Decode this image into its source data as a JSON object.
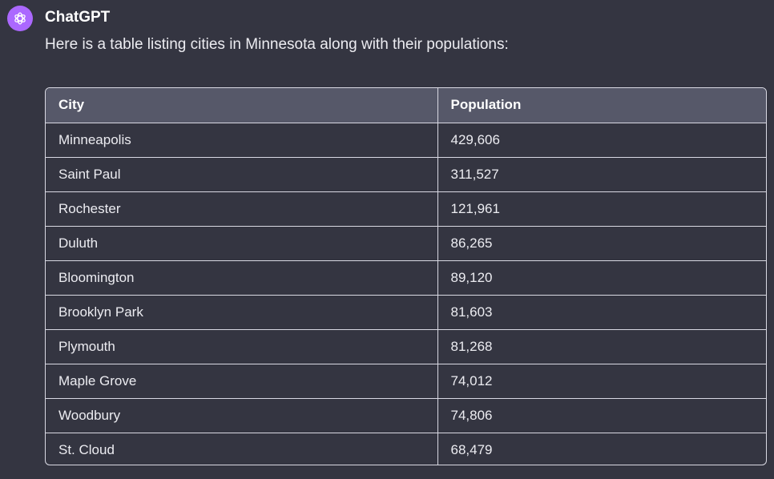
{
  "message": {
    "author": "ChatGPT",
    "avatar_icon": "openai-logo-icon",
    "avatar_color": "#ab68ff",
    "intro": "Here is a table listing cities in Minnesota along with their populations:"
  },
  "table": {
    "headers": [
      "City",
      "Population"
    ],
    "rows": [
      [
        "Minneapolis",
        "429,606"
      ],
      [
        "Saint Paul",
        "311,527"
      ],
      [
        "Rochester",
        "121,961"
      ],
      [
        "Duluth",
        "86,265"
      ],
      [
        "Bloomington",
        "89,120"
      ],
      [
        "Brooklyn Park",
        "81,603"
      ],
      [
        "Plymouth",
        "81,268"
      ],
      [
        "Maple Grove",
        "74,012"
      ],
      [
        "Woodbury",
        "74,806"
      ],
      [
        "St. Cloud",
        "68,479"
      ]
    ]
  }
}
